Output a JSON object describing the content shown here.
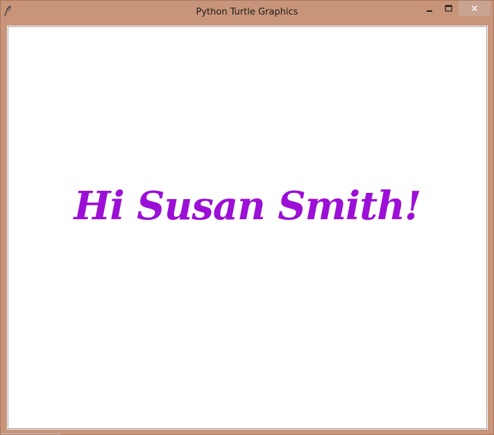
{
  "window": {
    "title": "Python Turtle Graphics",
    "app_icon": "feather-icon",
    "controls": {
      "minimize_icon": "minimize-icon",
      "maximize_icon": "maximize-icon",
      "close_icon": "close-icon"
    },
    "frame_color": "#c8957a"
  },
  "canvas": {
    "background": "#ffffff",
    "text": "Hi Susan Smith!",
    "text_color": "#9b0fd6"
  }
}
